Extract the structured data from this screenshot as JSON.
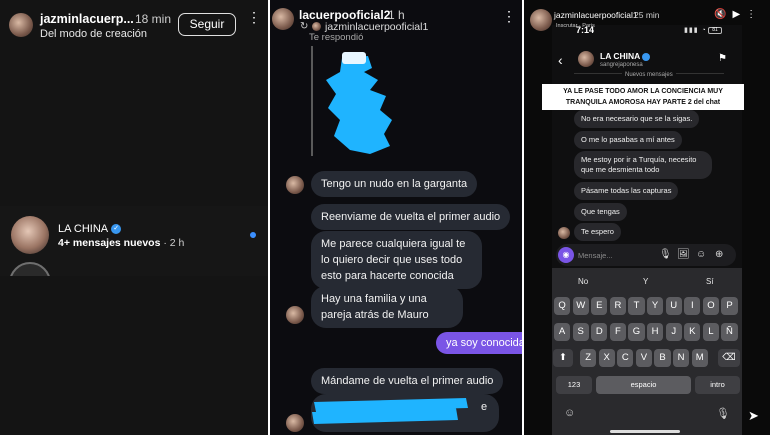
{
  "panel1": {
    "username": "jazminlacuerp...",
    "time": "18 min",
    "subtitle": "Del modo de creación",
    "follow_label": "Seguir",
    "more_icon": "⋮",
    "conversation": {
      "name": "LA CHINA",
      "verified_icon": "✓",
      "preview": "4+ mensajes nuevos",
      "time": "· 2 h",
      "unread_color": "#3b8fff"
    },
    "next_preview_cut": "C..."
  },
  "panel2": {
    "username": "lacuerpooficial2",
    "time": "1 h",
    "more_icon": "⋮",
    "reply_icon": "↻",
    "replied_user": "jazminlacuerpooficial1",
    "replied_note": "Te respondió",
    "messages": [
      "Tengo un nudo en la garganta",
      "Reenviame de vuelta el primer audio",
      "Me parece cualquiera igual te lo quiero decir que uses todo esto para hacerte conocida",
      "Hay una familia y una pareja atrás de Mauro",
      "ya soy conocida",
      "Mándame de vuelta el primer audio",
      "e"
    ],
    "accent": "#7a55e6",
    "scribble_color": "#1fb4ff"
  },
  "panel3": {
    "username": "jazminlacuerpooficial1",
    "time": "25 min",
    "top_icons": "🔇▶⋮",
    "status_time": "7:14",
    "carrier": "Inscrutar · Paris",
    "signal": "▮▮▮ ◔",
    "battery": "81",
    "header_name": "LA CHINA",
    "header_sub": "sangrejaponesa",
    "flag_icon": "⚑",
    "back_icon": "‹",
    "new_messages": "Nuevos mensajes",
    "caption": "YA LE PASE TODO AMOR LA CONCIENCIA MUY TRANQUILA AMOROSA HAY PARTE 2 del chat",
    "messages": [
      "No era necesario que se la sigas.",
      "O me lo pasabas a mí antes",
      "Me estoy por ir a Turquía, necesito que me desmienta todo",
      "Pásame todas las capturas",
      "Que tengas",
      "Te espero"
    ],
    "composer_placeholder": "Mensaje...",
    "composer_icons": [
      "🎙",
      "🖼",
      "☺",
      "⊕"
    ],
    "suggestions": [
      "No",
      "Y",
      "Sí"
    ],
    "keys_row1": [
      "Q",
      "W",
      "E",
      "R",
      "T",
      "Y",
      "U",
      "I",
      "O",
      "P"
    ],
    "keys_row2": [
      "A",
      "S",
      "D",
      "F",
      "G",
      "H",
      "J",
      "K",
      "L",
      "Ñ"
    ],
    "keys_row3": [
      "Z",
      "X",
      "C",
      "V",
      "B",
      "N",
      "M"
    ],
    "key_shift": "⬆",
    "key_delete": "⌫",
    "key_123": "123",
    "key_space": "espacio",
    "key_return": "intro",
    "emoji_icon": "☺",
    "mic_icon": "🎙",
    "send_icon": "➤"
  }
}
